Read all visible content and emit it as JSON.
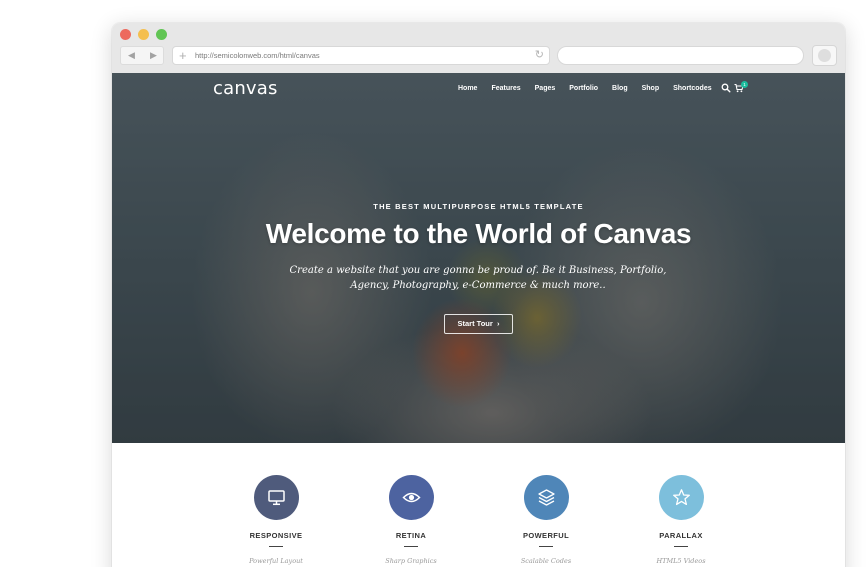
{
  "browser": {
    "url": "http://semicolonweb.com/html/canvas",
    "icons": {
      "back": "arrow-left-icon",
      "forward": "arrow-right-icon",
      "new_tab": "plus-icon",
      "reload": "reload-icon",
      "extension": "extension-icon"
    },
    "traffic_lights": [
      "#ed6a5e",
      "#f4bf4f",
      "#61c554"
    ]
  },
  "site": {
    "logo": "canvas",
    "menu": [
      "Home",
      "Features",
      "Pages",
      "Portfolio",
      "Blog",
      "Shop",
      "Shortcodes"
    ],
    "cart_count": "1",
    "hero": {
      "kicker": "THE BEST MULTIPURPOSE HTML5 TEMPLATE",
      "title": "Welcome to the World of Canvas",
      "lead_line1": "Create a website that you are gonna be proud of. Be it Business, Portfolio,",
      "lead_line2": "Agency, Photography, e-Commerce & much more..",
      "button": "Start Tour"
    },
    "features": [
      {
        "title": "RESPONSIVE",
        "subtitle": "Powerful Layout",
        "icon": "monitor-icon",
        "color": "#4f5b7c"
      },
      {
        "title": "RETINA",
        "subtitle": "Sharp Graphics",
        "icon": "eye-icon",
        "color": "#4d63a0"
      },
      {
        "title": "POWERFUL",
        "subtitle": "Scalable Codes",
        "icon": "layers-icon",
        "color": "#4f86b8"
      },
      {
        "title": "PARALLAX",
        "subtitle": "HTML5 Videos",
        "icon": "star-icon",
        "color": "#7dbfdc"
      }
    ]
  }
}
